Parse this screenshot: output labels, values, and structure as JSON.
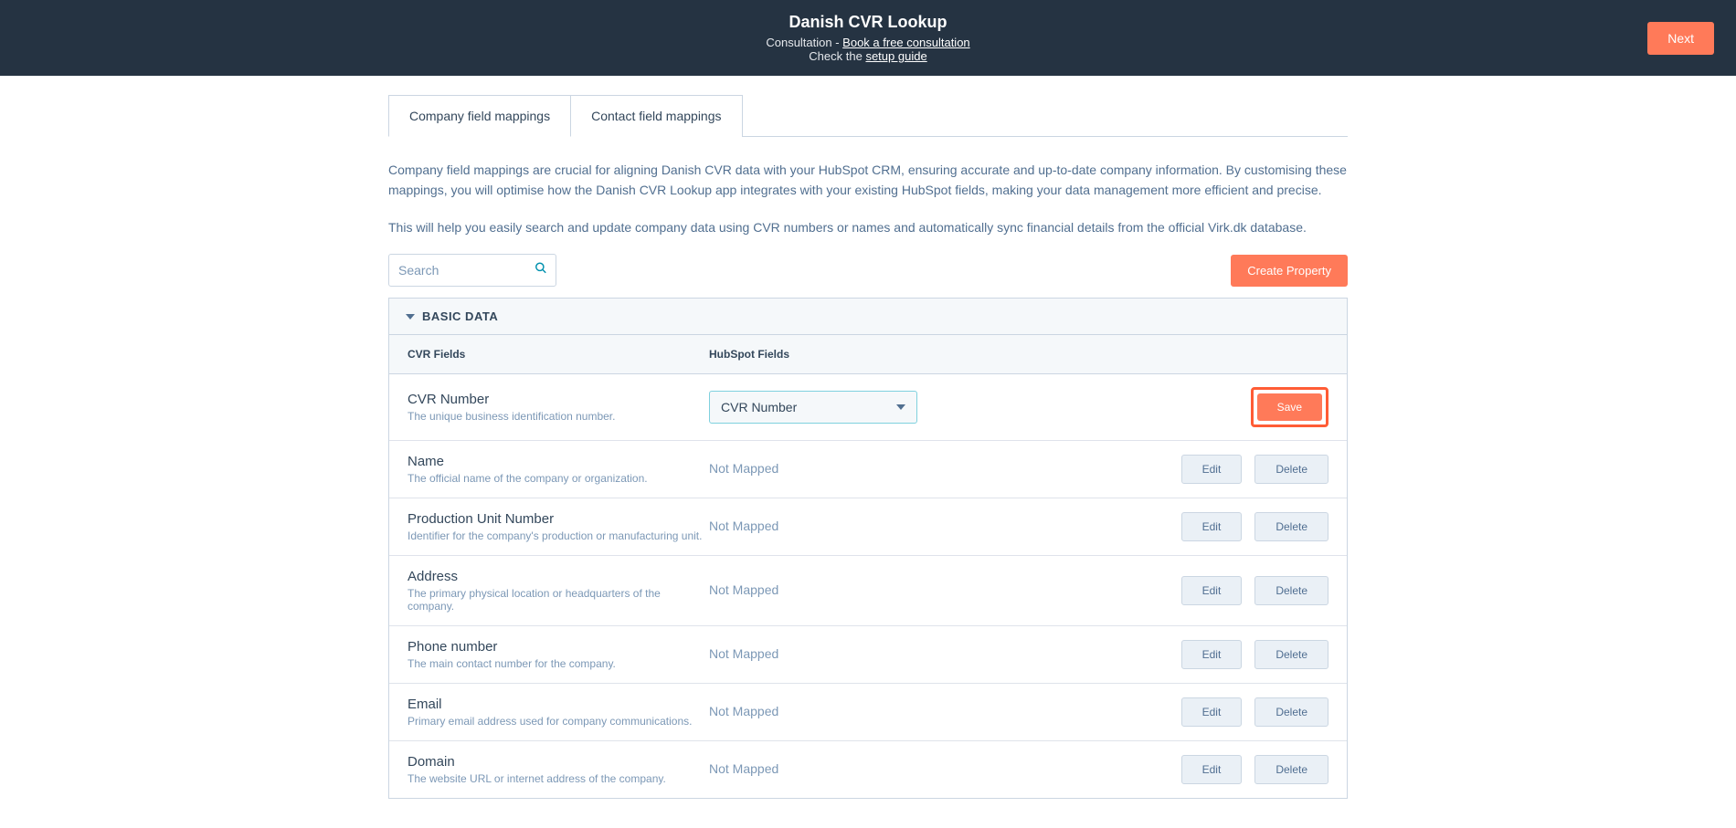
{
  "header": {
    "title": "Danish CVR Lookup",
    "consultation_prefix": "Consultation - ",
    "consultation_link": "Book a free consultation",
    "check_prefix": "Check the ",
    "setup_link": "setup guide",
    "next": "Next"
  },
  "tabs": {
    "company": "Company field mappings",
    "contact": "Contact field mappings"
  },
  "intro": {
    "p1": "Company field mappings are crucial for aligning Danish CVR data with your HubSpot CRM, ensuring accurate and up-to-date company information. By customising these mappings, you will optimise how the Danish CVR Lookup app integrates with your existing HubSpot fields, making your data management more efficient and precise.",
    "p2": "This will help you easily search and update company data using CVR numbers or names and automatically sync financial details from the official Virk.dk database."
  },
  "toolbar": {
    "search_placeholder": "Search",
    "create": "Create Property"
  },
  "section": {
    "title": "BASIC DATA"
  },
  "columns": {
    "cvr": "CVR Fields",
    "hubspot": "HubSpot Fields"
  },
  "buttons": {
    "save": "Save",
    "edit": "Edit",
    "delete": "Delete"
  },
  "not_mapped": "Not Mapped",
  "rows": [
    {
      "name": "CVR Number",
      "desc": "The unique business identification number.",
      "mapped": true,
      "mapped_value": "CVR Number",
      "save_mode": true
    },
    {
      "name": "Name",
      "desc": "The official name of the company or organization.",
      "mapped": false
    },
    {
      "name": "Production Unit Number",
      "desc": "Identifier for the company's production or manufacturing unit.",
      "mapped": false
    },
    {
      "name": "Address",
      "desc": "The primary physical location or headquarters of the company.",
      "mapped": false
    },
    {
      "name": "Phone number",
      "desc": "The main contact number for the company.",
      "mapped": false
    },
    {
      "name": "Email",
      "desc": "Primary email address used for company communications.",
      "mapped": false
    },
    {
      "name": "Domain",
      "desc": "The website URL or internet address of the company.",
      "mapped": false
    }
  ]
}
